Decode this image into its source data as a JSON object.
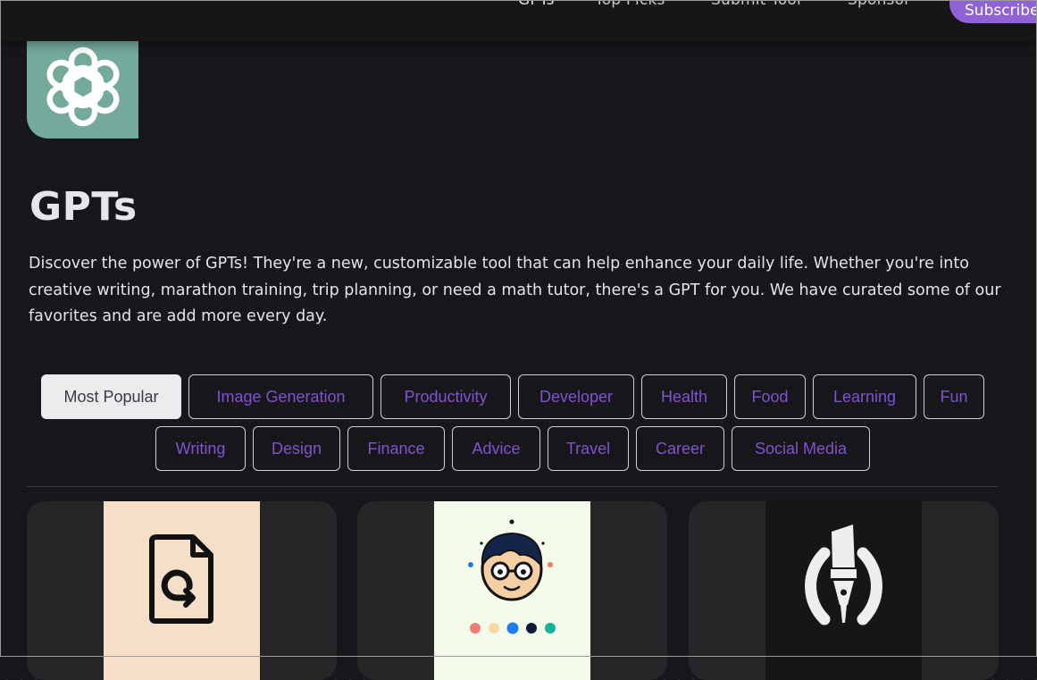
{
  "nav": {
    "items": [
      {
        "label": "GPTs"
      },
      {
        "label": "Top Picks"
      },
      {
        "label": "Submit Tool"
      },
      {
        "label": "Sponsor"
      }
    ],
    "subscribe_label": "Subscribe"
  },
  "page": {
    "title": "GPTs",
    "description": "Discover the power of GPTs! They're a new, customizable tool that can help enhance your daily life. Whether you're into creative writing, marathon training, trip planning, or need a math tutor, there's a GPT for you. We have curated some of our favorites and are add more every day."
  },
  "categories": {
    "active": "Most Popular",
    "items": [
      {
        "label": "Most Popular"
      },
      {
        "label": "Image Generation"
      },
      {
        "label": "Productivity"
      },
      {
        "label": "Developer"
      },
      {
        "label": "Health"
      },
      {
        "label": "Food"
      },
      {
        "label": "Learning"
      },
      {
        "label": "Fun"
      },
      {
        "label": "Writing"
      },
      {
        "label": "Design"
      },
      {
        "label": "Finance"
      },
      {
        "label": "Advice"
      },
      {
        "label": "Travel"
      },
      {
        "label": "Career"
      },
      {
        "label": "Social Media"
      }
    ]
  },
  "cards": [
    {
      "icon": "file-convert-icon",
      "thumb_bg": "#f6dfc9"
    },
    {
      "icon": "cartoon-avatar-icon",
      "thumb_bg": "#f5fbea",
      "palette": [
        "#ee7d74",
        "#f7d9a8",
        "#1f7df0",
        "#0e1a3a",
        "#12b39a"
      ]
    },
    {
      "icon": "paintbrush-icon",
      "thumb_bg": "#161616"
    }
  ],
  "colors": {
    "background": "#17171b",
    "accent": "#8f63d6",
    "chip_text": "#7f52cf",
    "logo_bg": "#74aa9c"
  }
}
